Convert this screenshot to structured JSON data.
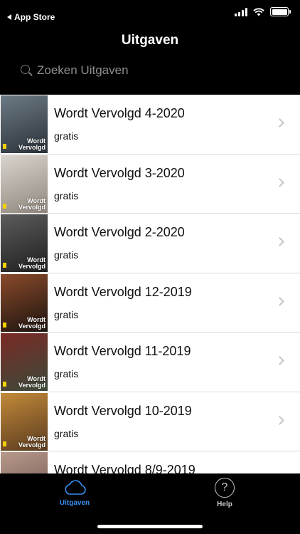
{
  "status_bar": {
    "back_label": "App Store"
  },
  "nav": {
    "title": "Uitgaven"
  },
  "search": {
    "placeholder": "Zoeken Uitgaven"
  },
  "issues": [
    {
      "title": "Wordt Vervolgd 4-2020",
      "price": "gratis",
      "cover_text": "Wordt Vervolgd",
      "cover_colors": [
        "#6d7a84",
        "#2a3138"
      ]
    },
    {
      "title": "Wordt Vervolgd 3-2020",
      "price": "gratis",
      "cover_text": "Wordt Vervolgd",
      "cover_colors": [
        "#d9d4cd",
        "#8f877d"
      ]
    },
    {
      "title": "Wordt Vervolgd 2-2020",
      "price": "gratis",
      "cover_text": "Wordt Vervolgd",
      "cover_colors": [
        "#5c5c5c",
        "#1f1f1f"
      ]
    },
    {
      "title": "Wordt Vervolgd 12-2019",
      "price": "gratis",
      "cover_text": "Wordt Vervolgd",
      "cover_colors": [
        "#8a4a2a",
        "#1c1410"
      ]
    },
    {
      "title": "Wordt Vervolgd 11-2019",
      "price": "gratis",
      "cover_text": "Wordt Vervolgd",
      "cover_colors": [
        "#7a2a25",
        "#3b4a3a"
      ]
    },
    {
      "title": "Wordt Vervolgd 10-2019",
      "price": "gratis",
      "cover_text": "Wordt Vervolgd",
      "cover_colors": [
        "#c28a3a",
        "#5a3a1e"
      ]
    },
    {
      "title": "Wordt Vervolgd 8/9-2019",
      "price": "",
      "cover_text": "",
      "cover_colors": [
        "#b89a8a",
        "#6a5050"
      ]
    }
  ],
  "tabs": [
    {
      "label": "Uitgaven",
      "icon": "cloud-icon",
      "active": true,
      "color": "#3b8ef0"
    },
    {
      "label": "Help",
      "icon": "help-icon",
      "active": false,
      "color": "#c9c9c9",
      "glyph": "?"
    }
  ]
}
